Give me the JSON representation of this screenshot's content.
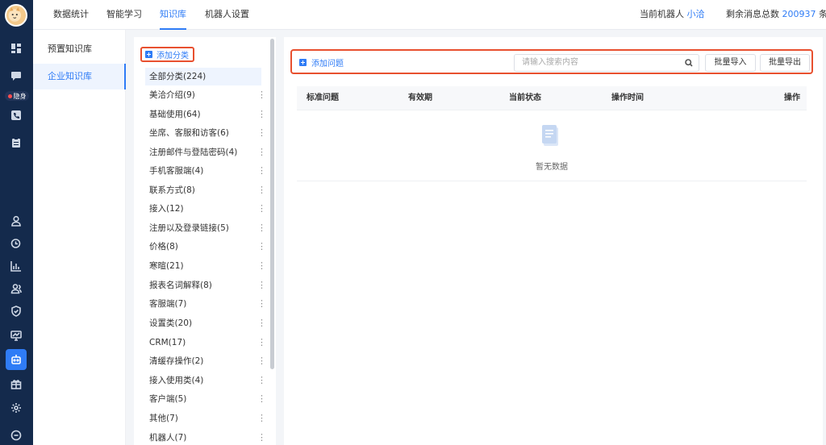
{
  "app": {
    "brand_color": "#2f7cf6",
    "rail_color": "#142a4c",
    "highlight_color": "#e8502f"
  },
  "rail": {
    "badge_label": "隐身",
    "icons": [
      "avatar-cat-icon",
      "dashboard-icon",
      "chat-icon",
      "phone-icon",
      "clipboard-icon",
      "user-icon",
      "clock-icon",
      "bar-chart-icon",
      "team-icon",
      "shield-icon",
      "monitor-icon",
      "robot-icon",
      "gift-icon",
      "gear-icon",
      "chat-bubble-icon"
    ]
  },
  "topbar": {
    "tabs": [
      {
        "label": "数据统计"
      },
      {
        "label": "智能学习"
      },
      {
        "label": "知识库"
      },
      {
        "label": "机器人设置"
      }
    ],
    "active_tab": "知识库",
    "robot_label": "当前机器人",
    "robot_name": "小洽",
    "remaining_label": "剩余消息总数",
    "remaining_count": "200937",
    "remaining_unit": "条"
  },
  "leftnav": {
    "items": [
      {
        "label": "预置知识库"
      },
      {
        "label": "企业知识库"
      }
    ],
    "active": "企业知识库"
  },
  "categories": {
    "add_label": "添加分类",
    "items": [
      {
        "label": "全部分类(224)"
      },
      {
        "label": "美洽介绍(9)"
      },
      {
        "label": "基础使用(64)"
      },
      {
        "label": "坐席、客服和访客(6)"
      },
      {
        "label": "注册邮件与登陆密码(4)"
      },
      {
        "label": "手机客服端(4)"
      },
      {
        "label": "联系方式(8)"
      },
      {
        "label": "接入(12)"
      },
      {
        "label": "注册以及登录链接(5)"
      },
      {
        "label": "价格(8)"
      },
      {
        "label": "寒暄(21)"
      },
      {
        "label": "报表名词解释(8)"
      },
      {
        "label": "客服端(7)"
      },
      {
        "label": "设置类(20)"
      },
      {
        "label": "CRM(17)"
      },
      {
        "label": "清缓存操作(2)"
      },
      {
        "label": "接入使用类(4)"
      },
      {
        "label": "客户端(5)"
      },
      {
        "label": "其他(7)"
      },
      {
        "label": "机器人(7)"
      }
    ],
    "more_symbol": "⋮"
  },
  "main": {
    "add_question_label": "添加问题",
    "search_placeholder": "请输入搜索内容",
    "batch_import_label": "批量导入",
    "batch_export_label": "批量导出",
    "columns": [
      "标准问题",
      "有效期",
      "当前状态",
      "操作时间",
      "操作"
    ],
    "empty_text": "暂无数据"
  }
}
